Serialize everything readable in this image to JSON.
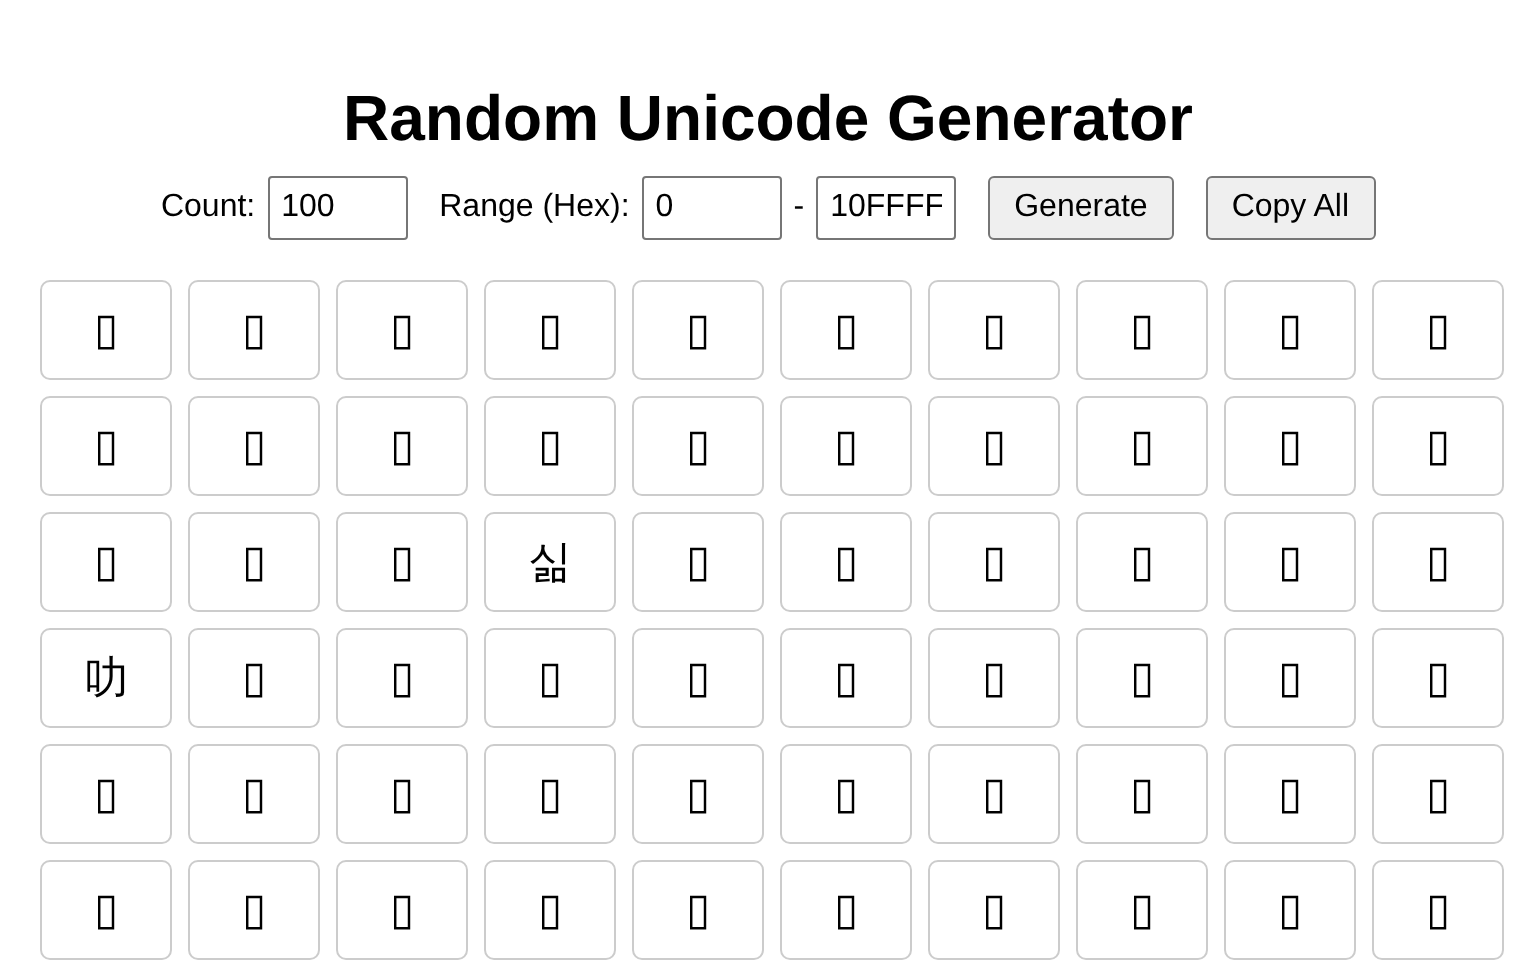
{
  "title": "Random Unicode Generator",
  "controls": {
    "count_label": "Count:",
    "count_value": "100",
    "range_label": "Range (Hex):",
    "range_start": "0",
    "range_separator": "-",
    "range_end": "10FFFF",
    "buttons": [
      "Generate",
      "Copy All"
    ]
  },
  "characters": [
    "▯",
    "▯",
    "▯",
    "▯",
    "▯",
    "▯",
    "▯",
    "▯",
    "▯",
    "▯",
    "▯",
    "▯",
    "▯",
    "▯",
    "▯",
    "▯",
    "▯",
    "▯",
    "▯",
    "▯",
    "▯",
    "▯",
    "▯",
    "싦",
    "▯",
    "▯",
    "▯",
    "▯",
    "▯",
    "▯",
    "叻",
    "▯",
    "▯",
    "▯",
    "▯",
    "▯",
    "▯",
    "▯",
    "▯",
    "▯",
    "▯",
    "▯",
    "▯",
    "▯",
    "▯",
    "▯",
    "▯",
    "▯",
    "▯",
    "▯",
    "▯",
    "▯",
    "▯",
    "▯",
    "▯",
    "▯",
    "▯",
    "▯",
    "▯",
    "▯"
  ]
}
